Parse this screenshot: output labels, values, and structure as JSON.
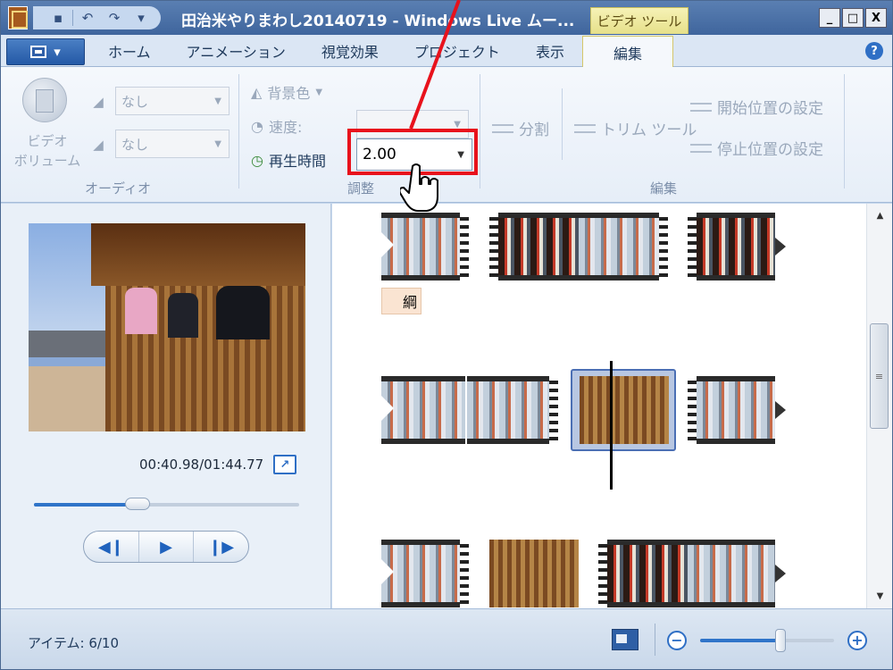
{
  "window": {
    "title": "田治米やりまわし20140719 - Windows Live ムー...",
    "context_tab": "ビデオ ツール",
    "controls": [
      "_",
      "□",
      "X"
    ]
  },
  "qat": {
    "icons": [
      "save-icon",
      "undo-icon",
      "redo-icon",
      "dropdown-icon"
    ]
  },
  "tabs": [
    {
      "label": "ホーム"
    },
    {
      "label": "アニメーション"
    },
    {
      "label": "視覚効果"
    },
    {
      "label": "プロジェクト"
    },
    {
      "label": "表示"
    },
    {
      "label": "編集"
    }
  ],
  "active_tab": "編集",
  "ribbon": {
    "audio": {
      "group_label": "オーディオ",
      "volume_label_line1": "ビデオ",
      "volume_label_line2": "ボリューム",
      "fade_in_value": "なし",
      "fade_out_value": "なし"
    },
    "adjust": {
      "group_label": "調整",
      "background_color": "背景色",
      "speed_label": "速度:",
      "speed_value": "",
      "duration_label": "再生時間",
      "duration_value": "2.00"
    },
    "edit": {
      "group_label": "編集",
      "split": "分割",
      "trim_tool": "トリム ツール",
      "set_start": "開始位置の設定",
      "set_end": "停止位置の設定"
    }
  },
  "preview": {
    "timecode": "00:40.98/01:44.77",
    "seek_fraction": 0.39,
    "transport": [
      "◀❙",
      "▶",
      "❙▶"
    ]
  },
  "storyboard": {
    "caption_text": "綱"
  },
  "status": {
    "items_text": "アイテム: 6/10",
    "zoom_fraction": 0.6
  },
  "colors": {
    "accent": "#2f6fc5",
    "highlight": "#e8121c",
    "context_tab": "#e6e08a"
  }
}
